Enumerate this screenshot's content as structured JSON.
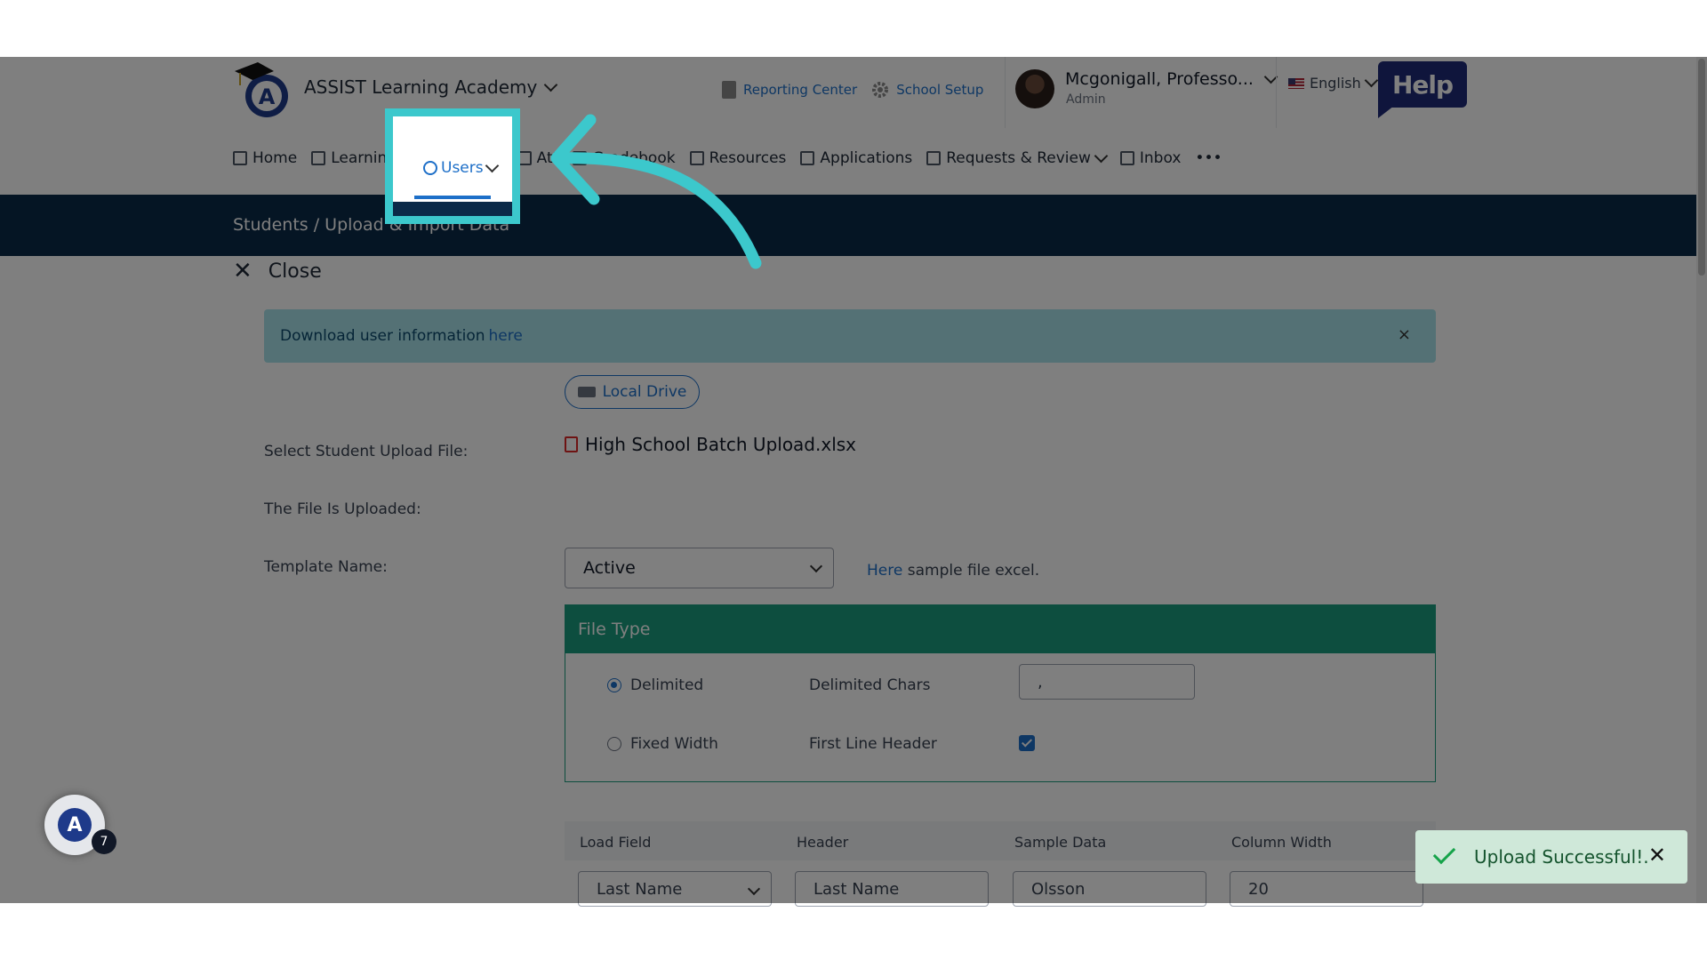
{
  "header": {
    "school_name": "ASSIST Learning Academy",
    "reporting_center": "Reporting Center",
    "school_setup": "School Setup",
    "user_name": "Mcgonigall, Professo...",
    "user_role": "Admin",
    "language": "English",
    "help": "Help"
  },
  "nav": {
    "home": "Home",
    "learning": "Learning",
    "users": "Users",
    "attendance": "Att",
    "gradebook": "Gradebook",
    "resources": "Resources",
    "applications": "Applications",
    "requests": "Requests & Review",
    "inbox": "Inbox",
    "more": "•••"
  },
  "breadcrumb": "Students  /  Upload & Import Data",
  "close_label": "Close",
  "alert": {
    "text": "Download user information",
    "link": "here",
    "close": "×"
  },
  "form": {
    "select_file_label": "Select Student Upload File:",
    "local_drive": "Local Drive",
    "uploaded_label": "The File Is Uploaded:",
    "file_name": "High School Batch Upload.xlsx",
    "template_label": "Template Name:",
    "template_value": "Active",
    "sample_link": "Here",
    "sample_text": " sample file excel."
  },
  "file_type": {
    "title": "File Type",
    "delimited": "Delimited",
    "delimited_chars_label": "Delimited Chars",
    "delimited_chars_value": ",",
    "fixed_width": "Fixed Width",
    "first_line_header": "First Line Header"
  },
  "table": {
    "headers": [
      "Load Field",
      "Header",
      "Sample Data",
      "Column Width"
    ],
    "row": [
      "Last Name",
      "Last Name",
      "Olsson",
      "20"
    ]
  },
  "fab_badge": "7",
  "toast": {
    "text": "Upload Successful!.",
    "close": "✕"
  },
  "colors": {
    "accent": "#1d6fc8",
    "header_bar": "#0b2a48",
    "panel": "#1a9d7e",
    "highlight": "#3cc8cc"
  }
}
